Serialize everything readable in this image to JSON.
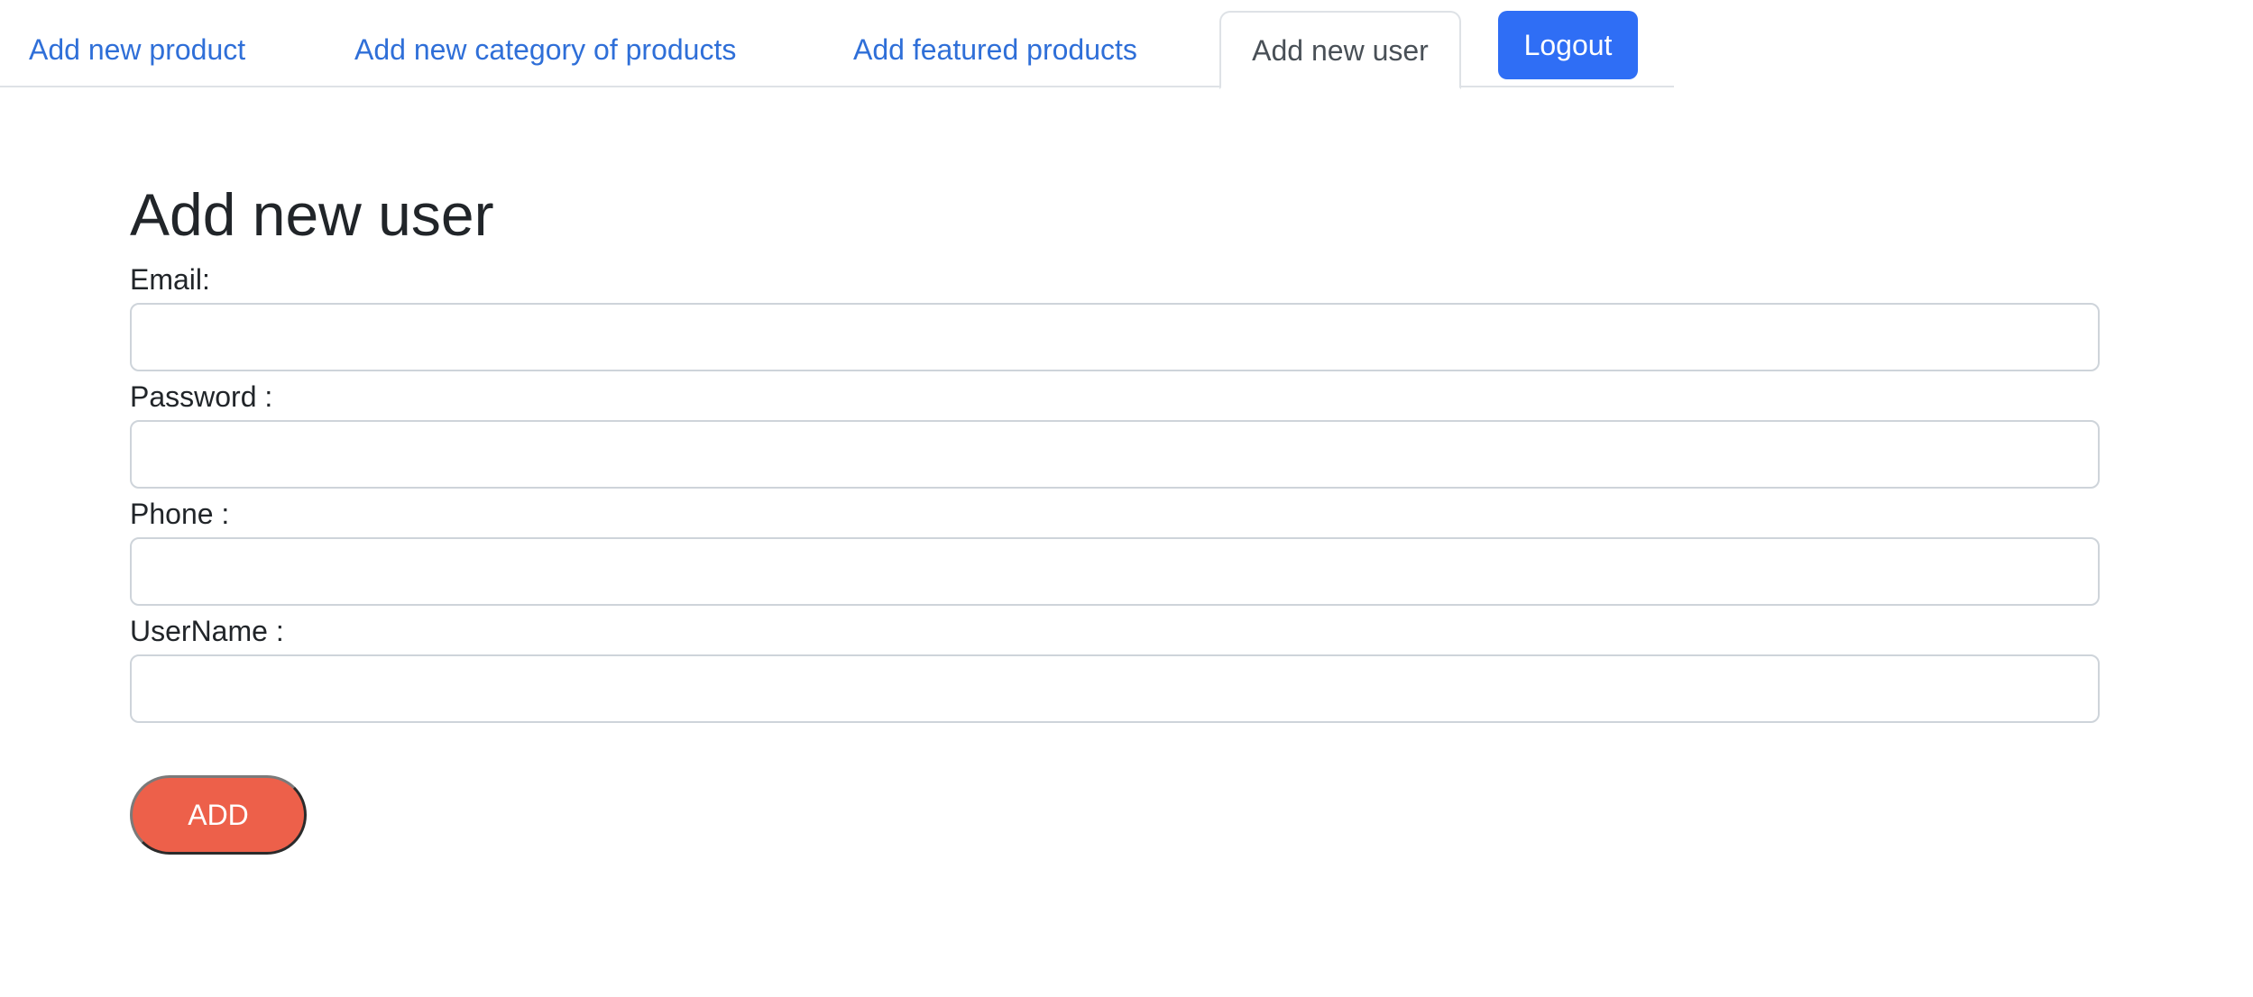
{
  "nav": {
    "links": [
      {
        "label": "Add new product"
      },
      {
        "label": "Add new category of products"
      },
      {
        "label": "Add featured products"
      }
    ],
    "active_tab": "Add new user",
    "logout_label": "Logout"
  },
  "form": {
    "title": "Add new user",
    "fields": [
      {
        "label": "Email:",
        "value": "",
        "placeholder": ""
      },
      {
        "label": "Password :",
        "value": "",
        "placeholder": ""
      },
      {
        "label": "Phone :",
        "value": "",
        "placeholder": ""
      },
      {
        "label": "UserName :",
        "value": "",
        "placeholder": ""
      }
    ],
    "submit_label": "ADD"
  },
  "colors": {
    "link": "#2f6fd8",
    "logout_button": "#2f6ef5",
    "add_button": "#ed604a"
  }
}
